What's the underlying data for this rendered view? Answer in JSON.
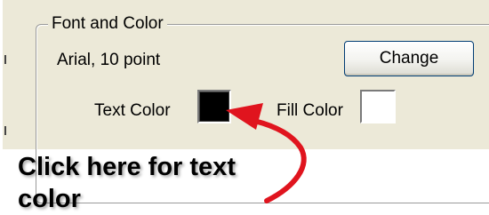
{
  "group": {
    "title": "Font and Color"
  },
  "font": {
    "current_value": "Arial, 10 point",
    "change_label": "Change"
  },
  "colors": {
    "text_color_label": "Text Color",
    "text_color_value": "#000000",
    "fill_color_label": "Fill Color",
    "fill_color_value": "#ffffff"
  },
  "annotation": {
    "callout_text": "Click here for text color",
    "arrow_color": "#e0141e"
  },
  "theme": {
    "panel_background": "#ece9d8"
  }
}
